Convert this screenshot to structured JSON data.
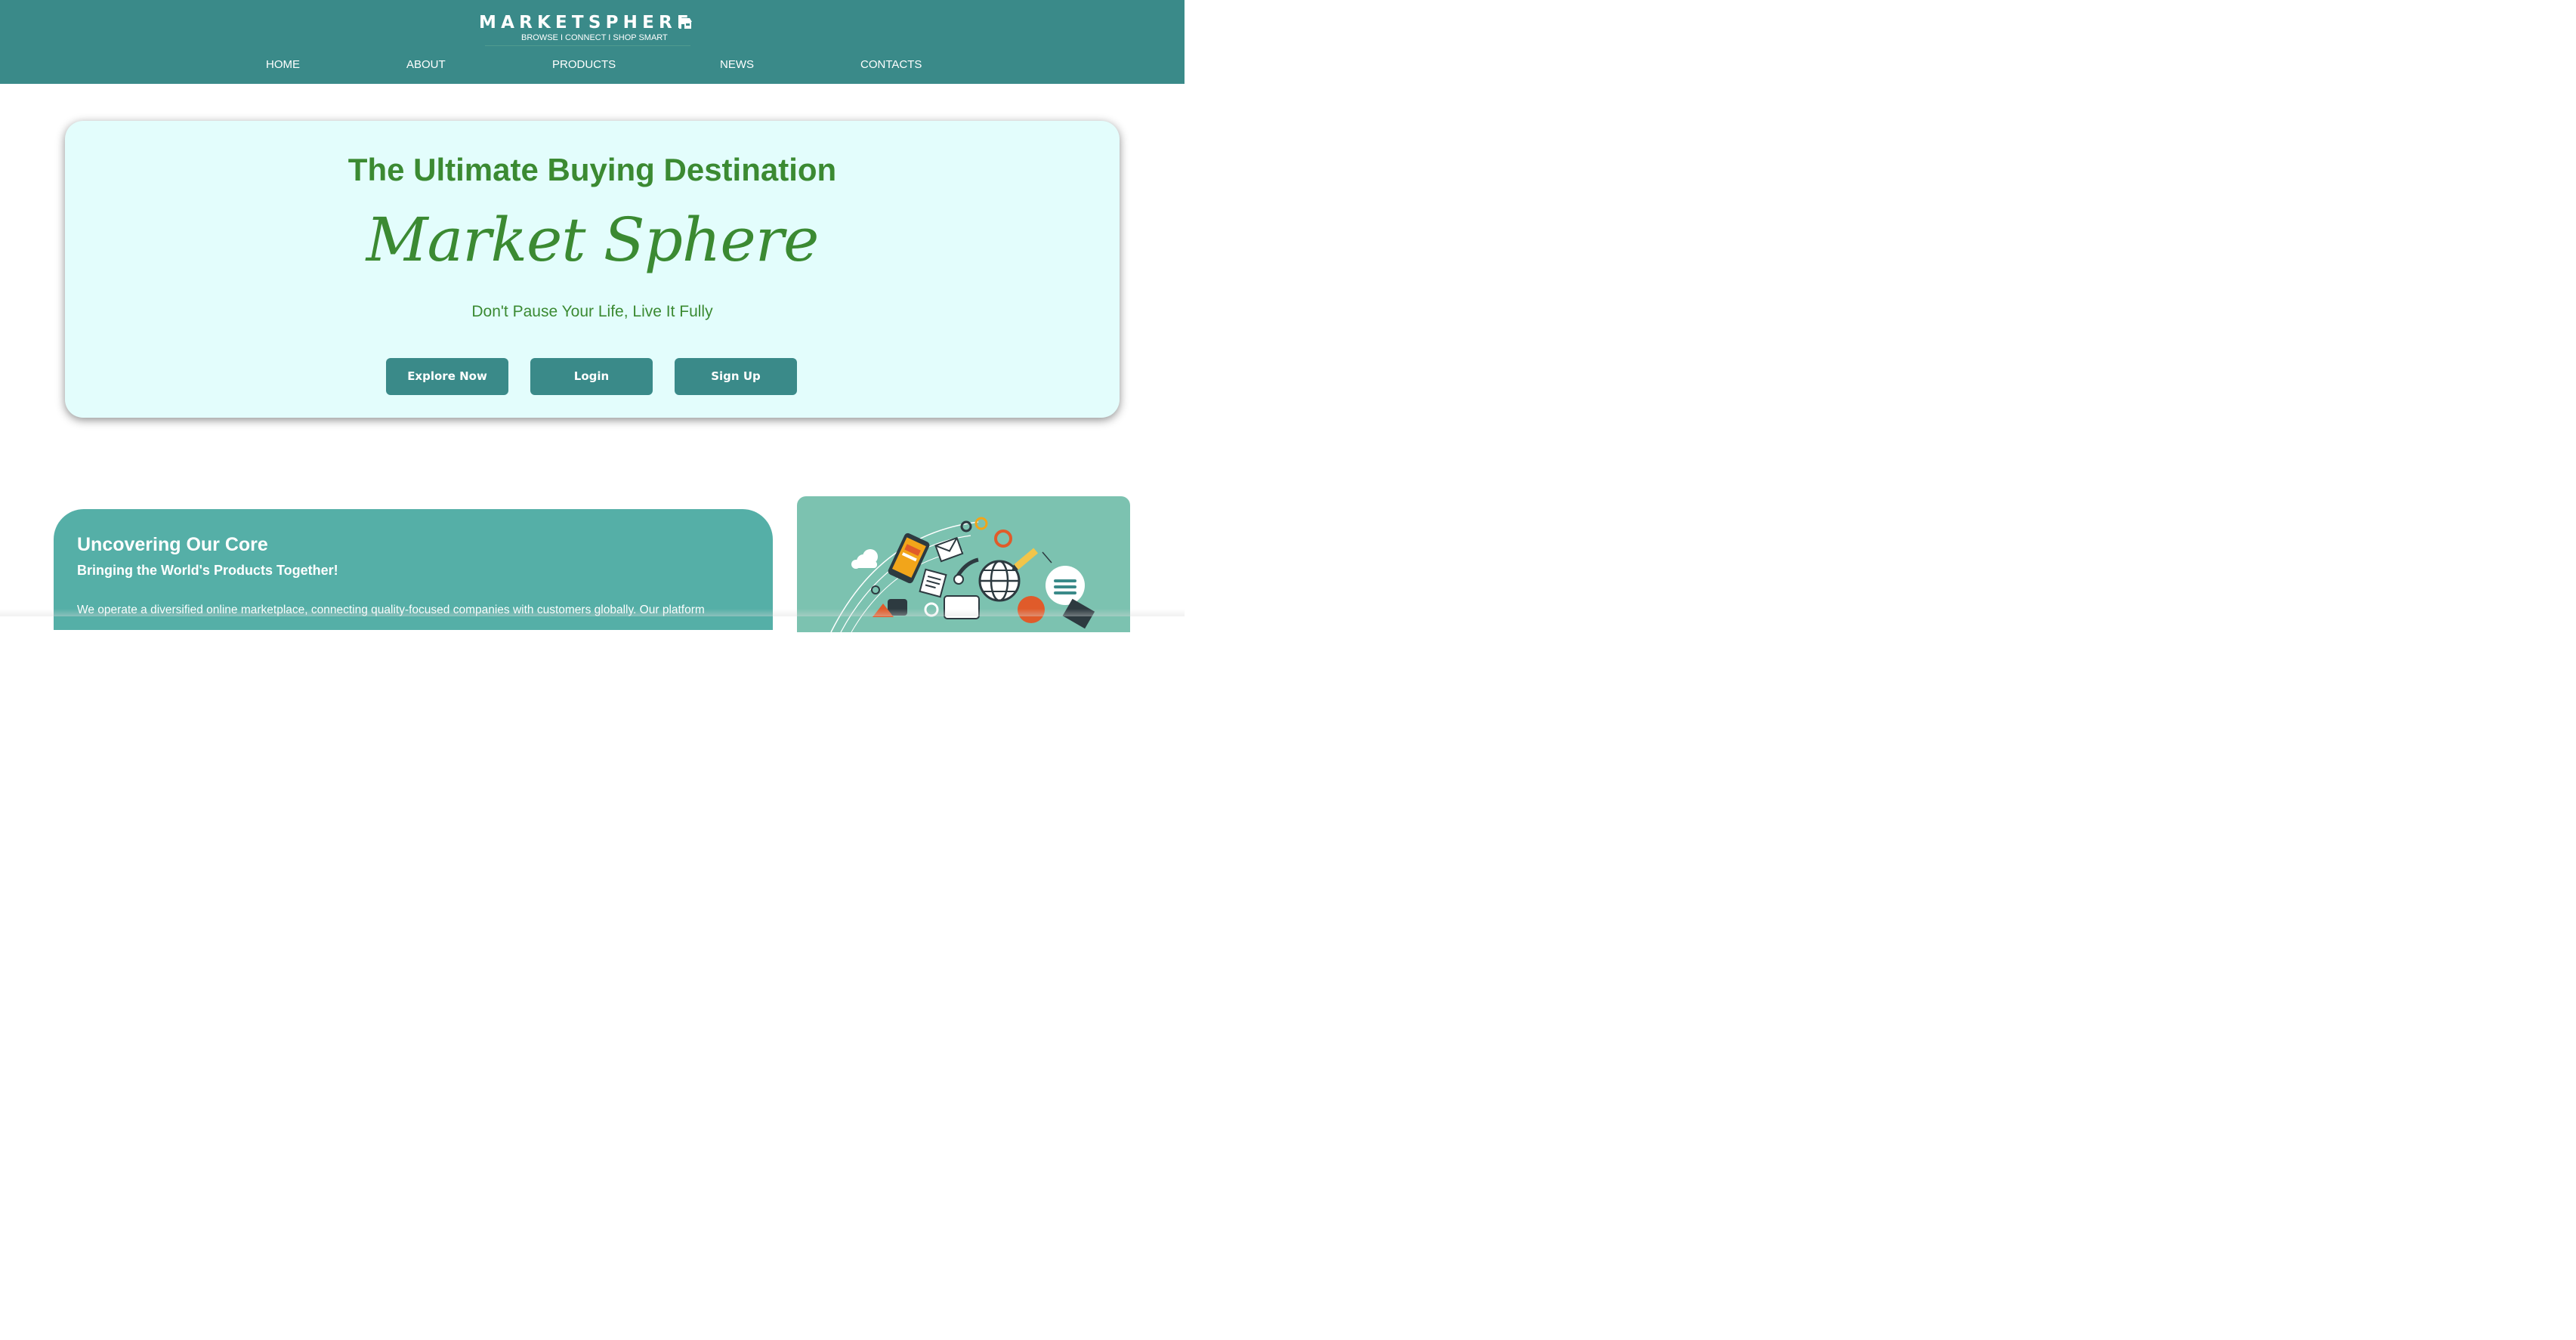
{
  "header": {
    "brand": "MARKETSPHERE",
    "tagline": "BROWSE I CONNECT I SHOP SMART",
    "nav": [
      "HOME",
      "ABOUT",
      "PRODUCTS",
      "NEWS",
      "CONTACTS"
    ]
  },
  "hero": {
    "title": "The Ultimate Buying Destination",
    "script_title": "Market Sphere",
    "tagline": "Don't Pause Your Life, Live It Fully",
    "buttons": [
      "Explore Now",
      "Login",
      "Sign Up"
    ]
  },
  "about": {
    "title": "Uncovering Our Core",
    "subtitle": "Bringing the World's Products Together!",
    "body": "We operate a diversified online marketplace, connecting quality-focused companies with customers globally. Our platform"
  },
  "colors": {
    "header_bg": "#3a8a89",
    "hero_bg": "#e3fdfc",
    "hero_text": "#3b8a32",
    "button_bg": "#3a8a89",
    "about_bg": "#55afa7",
    "illustration_bg": "#7cc2b0"
  },
  "icons": [
    "storefront-icon",
    "marketing-illustration"
  ]
}
